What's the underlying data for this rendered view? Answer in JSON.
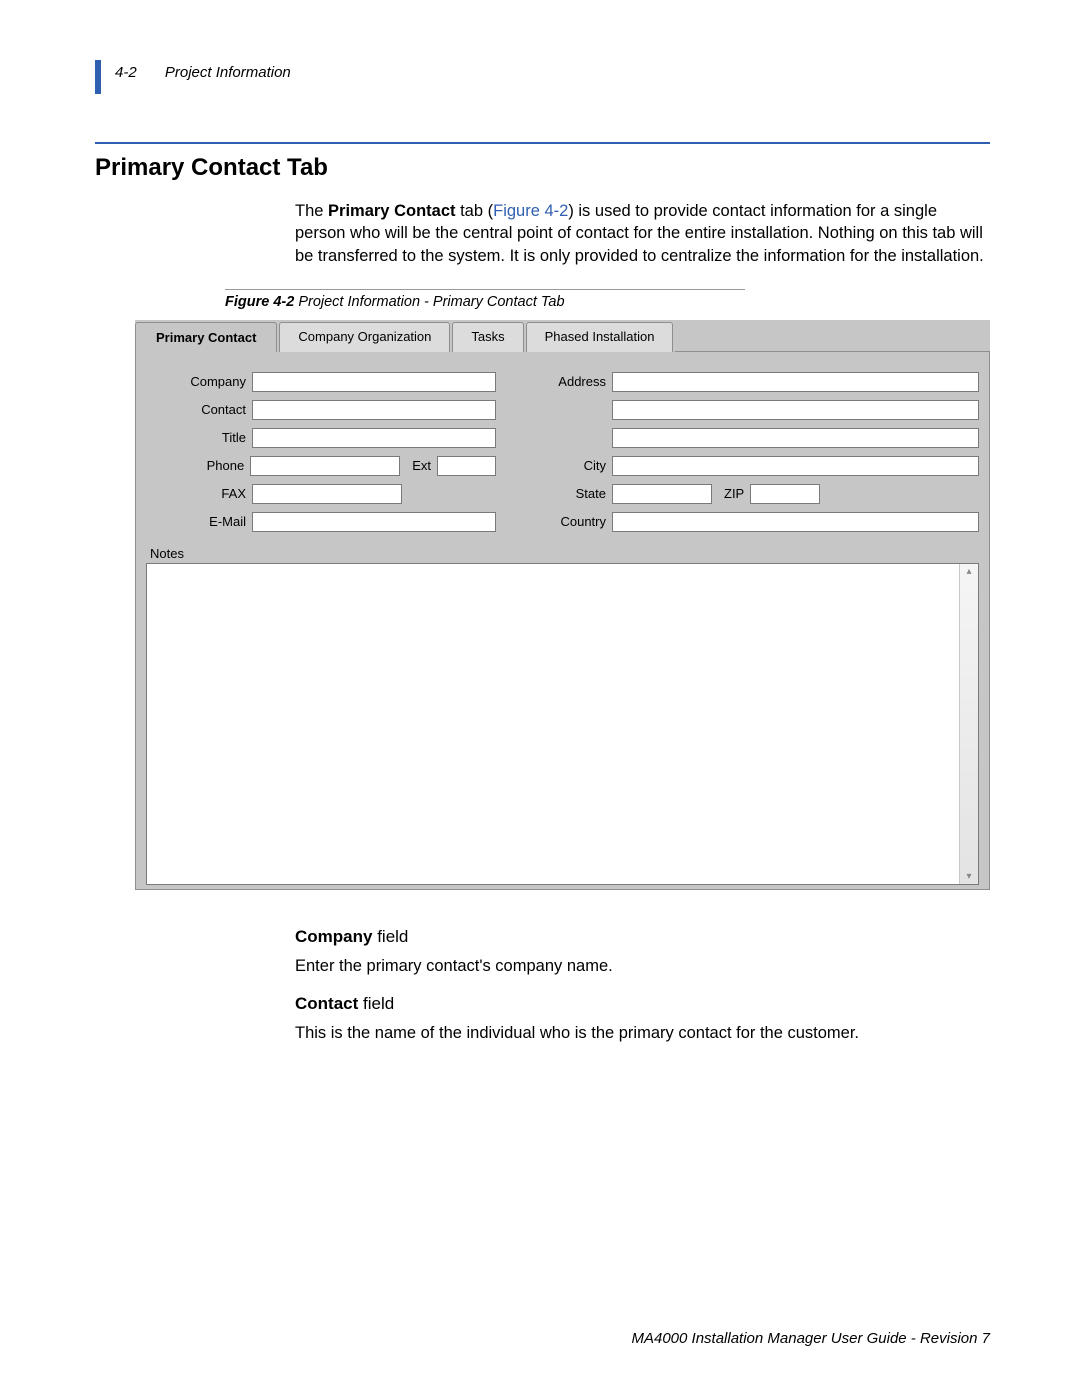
{
  "header": {
    "page_num": "4-2",
    "section": "Project Information"
  },
  "title": "Primary Contact Tab",
  "intro": {
    "pre": "The ",
    "bold": "Primary Contact",
    "mid1": " tab (",
    "link": "Figure 4-2",
    "mid2": ") is used to provide contact information for a single person who will be the central point of contact for the entire installation. Nothing on this tab will be transferred to the system. It is only provided to centralize the information for the installation."
  },
  "figure_caption": {
    "bold": "Figure 4-2",
    "rest": "  Project Information - Primary Contact Tab"
  },
  "tabs": {
    "active": "Primary Contact",
    "others": [
      "Company Organization",
      "Tasks",
      "Phased Installation"
    ]
  },
  "form": {
    "left": {
      "company": "Company",
      "contact": "Contact",
      "title": "Title",
      "phone": "Phone",
      "ext": "Ext",
      "fax": "FAX",
      "email": "E-Mail"
    },
    "right": {
      "address": "Address",
      "city": "City",
      "state": "State",
      "zip": "ZIP",
      "country": "Country"
    },
    "notes": "Notes",
    "values": {
      "company": "",
      "contact": "",
      "title": "",
      "phone": "",
      "ext": "",
      "fax": "",
      "email": "",
      "address1": "",
      "address2": "",
      "address3": "",
      "city": "",
      "state": "",
      "zip": "",
      "country": "",
      "notes": ""
    }
  },
  "defs": {
    "company_h_b": "Company",
    "company_h_r": " field",
    "company_p": "Enter the primary contact's company name.",
    "contact_h_b": "Contact",
    "contact_h_r": " field",
    "contact_p": "This is the name of the individual who is the primary contact for the customer."
  },
  "footer": "MA4000 Installation Manager User Guide - Revision 7"
}
